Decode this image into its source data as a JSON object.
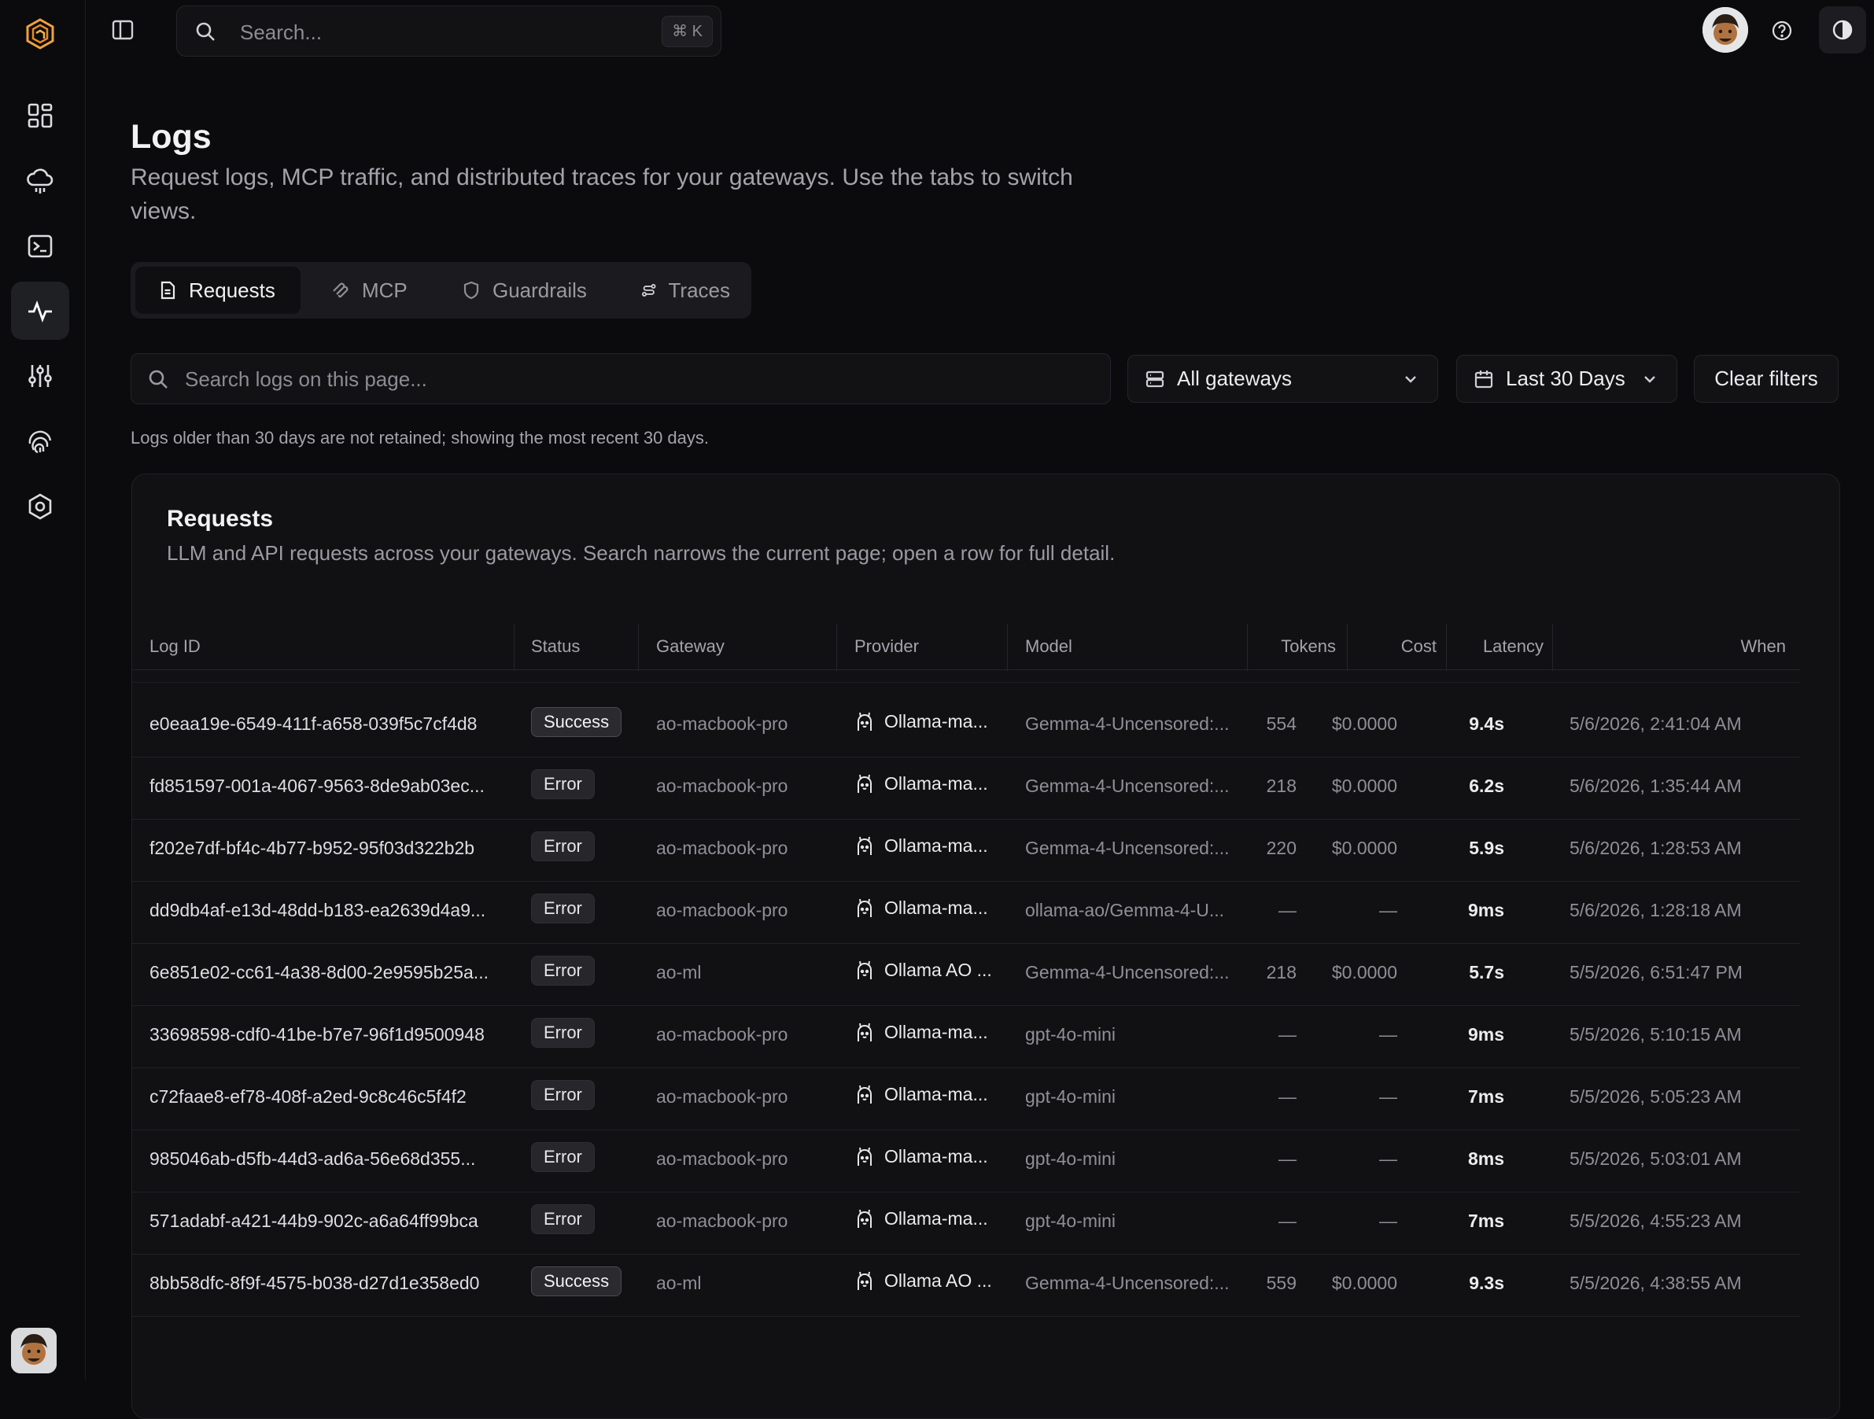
{
  "top": {
    "search_placeholder": "Search...",
    "shortcut": "⌘ K"
  },
  "sidebar": {
    "items": [
      {
        "icon": "dashboard-icon"
      },
      {
        "icon": "cloud-icon"
      },
      {
        "icon": "terminal-icon"
      },
      {
        "icon": "activity-icon",
        "active": true
      },
      {
        "icon": "sliders-icon"
      },
      {
        "icon": "fingerprint-icon"
      },
      {
        "icon": "settings-hex-icon"
      }
    ]
  },
  "page": {
    "title": "Logs",
    "subtitle": "Request logs, MCP traffic, and distributed traces for your gateways. Use the tabs to switch views."
  },
  "tabs": [
    {
      "label": "Requests",
      "icon": "document-icon",
      "active": true
    },
    {
      "label": "MCP",
      "icon": "mcp-icon"
    },
    {
      "label": "Guardrails",
      "icon": "shield-icon"
    },
    {
      "label": "Traces",
      "icon": "traces-icon"
    }
  ],
  "filters": {
    "search_placeholder": "Search logs on this page...",
    "gateway": "All gateways",
    "range": "Last 30 Days",
    "clear": "Clear filters",
    "retention_note": "Logs older than 30 days are not retained; showing the most recent 30 days."
  },
  "card": {
    "title": "Requests",
    "subtitle": "LLM and API requests across your gateways. Search narrows the current page; open a row for full detail."
  },
  "table": {
    "headers": {
      "log_id": "Log ID",
      "status": "Status",
      "gateway": "Gateway",
      "provider": "Provider",
      "model": "Model",
      "tokens": "Tokens",
      "cost": "Cost",
      "latency": "Latency",
      "when": "When"
    },
    "rows": [
      {
        "id": "e0eaa19e-6549-411f-a658-039f5c7cf4d8",
        "status": "Success",
        "gateway": "ao-macbook-pro",
        "provider": "Ollama-ma...",
        "model": "Gemma-4-Uncensored:...",
        "tokens": "554",
        "cost": "$0.0000",
        "latency": "9.4s",
        "when": "5/6/2026, 2:41:04 AM"
      },
      {
        "id": "fd851597-001a-4067-9563-8de9ab03ec...",
        "status": "Error",
        "gateway": "ao-macbook-pro",
        "provider": "Ollama-ma...",
        "model": "Gemma-4-Uncensored:...",
        "tokens": "218",
        "cost": "$0.0000",
        "latency": "6.2s",
        "when": "5/6/2026, 1:35:44 AM"
      },
      {
        "id": "f202e7df-bf4c-4b77-b952-95f03d322b2b",
        "status": "Error",
        "gateway": "ao-macbook-pro",
        "provider": "Ollama-ma...",
        "model": "Gemma-4-Uncensored:...",
        "tokens": "220",
        "cost": "$0.0000",
        "latency": "5.9s",
        "when": "5/6/2026, 1:28:53 AM"
      },
      {
        "id": "dd9db4af-e13d-48dd-b183-ea2639d4a9...",
        "status": "Error",
        "gateway": "ao-macbook-pro",
        "provider": "Ollama-ma...",
        "model": "ollama-ao/Gemma-4-U...",
        "tokens": "—",
        "cost": "—",
        "latency": "9ms",
        "when": "5/6/2026, 1:28:18 AM"
      },
      {
        "id": "6e851e02-cc61-4a38-8d00-2e9595b25a...",
        "status": "Error",
        "gateway": "ao-ml",
        "provider": "Ollama AO ...",
        "model": "Gemma-4-Uncensored:...",
        "tokens": "218",
        "cost": "$0.0000",
        "latency": "5.7s",
        "when": "5/5/2026, 6:51:47 PM"
      },
      {
        "id": "33698598-cdf0-41be-b7e7-96f1d9500948",
        "status": "Error",
        "gateway": "ao-macbook-pro",
        "provider": "Ollama-ma...",
        "model": "gpt-4o-mini",
        "tokens": "—",
        "cost": "—",
        "latency": "9ms",
        "when": "5/5/2026, 5:10:15 AM"
      },
      {
        "id": "c72faae8-ef78-408f-a2ed-9c8c46c5f4f2",
        "status": "Error",
        "gateway": "ao-macbook-pro",
        "provider": "Ollama-ma...",
        "model": "gpt-4o-mini",
        "tokens": "—",
        "cost": "—",
        "latency": "7ms",
        "when": "5/5/2026, 5:05:23 AM"
      },
      {
        "id": "985046ab-d5fb-44d3-ad6a-56e68d355...",
        "status": "Error",
        "gateway": "ao-macbook-pro",
        "provider": "Ollama-ma...",
        "model": "gpt-4o-mini",
        "tokens": "—",
        "cost": "—",
        "latency": "8ms",
        "when": "5/5/2026, 5:03:01 AM"
      },
      {
        "id": "571adabf-a421-44b9-902c-a6a64ff99bca",
        "status": "Error",
        "gateway": "ao-macbook-pro",
        "provider": "Ollama-ma...",
        "model": "gpt-4o-mini",
        "tokens": "—",
        "cost": "—",
        "latency": "7ms",
        "when": "5/5/2026, 4:55:23 AM"
      },
      {
        "id": "8bb58dfc-8f9f-4575-b038-d27d1e358ed0",
        "status": "Success",
        "gateway": "ao-ml",
        "provider": "Ollama AO ...",
        "model": "Gemma-4-Uncensored:...",
        "tokens": "559",
        "cost": "$0.0000",
        "latency": "9.3s",
        "when": "5/5/2026, 4:38:55 AM"
      }
    ]
  }
}
